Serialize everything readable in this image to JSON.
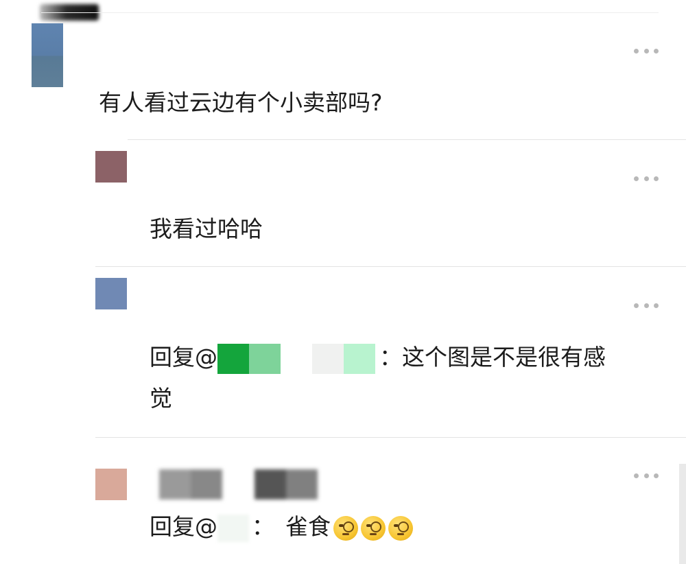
{
  "comments": [
    {
      "text": "有人看过云边有个小卖部吗?"
    },
    {
      "text": "我看过哈哈"
    },
    {
      "reply_prefix": "回复@",
      "separator": "：",
      "text_line1": "这个图是不是很有感",
      "text_line2": "觉"
    },
    {
      "reply_prefix": "回复@",
      "separator": "：",
      "text": "雀食",
      "emoji_count": 3,
      "emoji_name": "monocle-face"
    }
  ],
  "colors": {
    "avatar_1": "#5f7fa3",
    "avatar_2": "#8c6267",
    "avatar_3": "#7089b4",
    "avatar_4": "#d9a99a",
    "mention_green_dark": "#14a53c",
    "mention_green_light": "#7ed39a"
  }
}
